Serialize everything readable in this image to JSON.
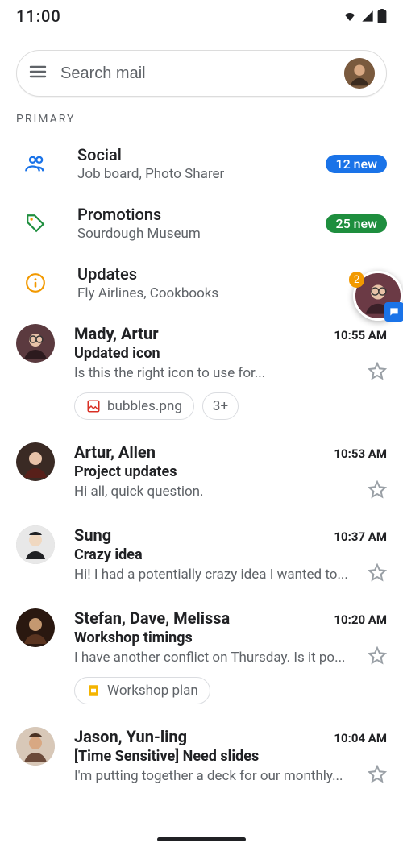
{
  "status": {
    "time": "11:00"
  },
  "search": {
    "placeholder": "Search mail"
  },
  "section_label": "PRIMARY",
  "categories": [
    {
      "id": "social",
      "title": "Social",
      "sub": "Job board, Photo Sharer",
      "badge": "12 new",
      "badge_color": "blue"
    },
    {
      "id": "promotions",
      "title": "Promotions",
      "sub": "Sourdough Museum",
      "badge": "25 new",
      "badge_color": "green"
    },
    {
      "id": "updates",
      "title": "Updates",
      "sub": "Fly Airlines, Cookbooks"
    }
  ],
  "emails": [
    {
      "senders": "Mady, Artur",
      "time": "10:55 AM",
      "subject": "Updated icon",
      "snippet": "Is this the right icon to use for...",
      "chips": [
        {
          "icon": "image",
          "label": "bubbles.png"
        },
        {
          "icon": "plus",
          "label": "3+"
        }
      ]
    },
    {
      "senders": "Artur, Allen",
      "time": "10:53 AM",
      "subject": "Project updates",
      "snippet": "Hi all, quick question."
    },
    {
      "senders": "Sung",
      "time": "10:37 AM",
      "subject": "Crazy idea",
      "snippet": "Hi! I had a potentially crazy idea I wanted to..."
    },
    {
      "senders": "Stefan, Dave, Melissa",
      "time": "10:20 AM",
      "subject": "Workshop timings",
      "snippet": "I have another conflict on Thursday. Is it po...",
      "chips": [
        {
          "icon": "slides",
          "label": "Workshop plan"
        }
      ]
    },
    {
      "senders": "Jason, Yun-ling",
      "time": "10:04 AM",
      "subject": "[Time Sensitive] Need slides",
      "snippet": "I'm putting together a deck for our monthly..."
    }
  ],
  "chathead": {
    "badge": "2"
  }
}
